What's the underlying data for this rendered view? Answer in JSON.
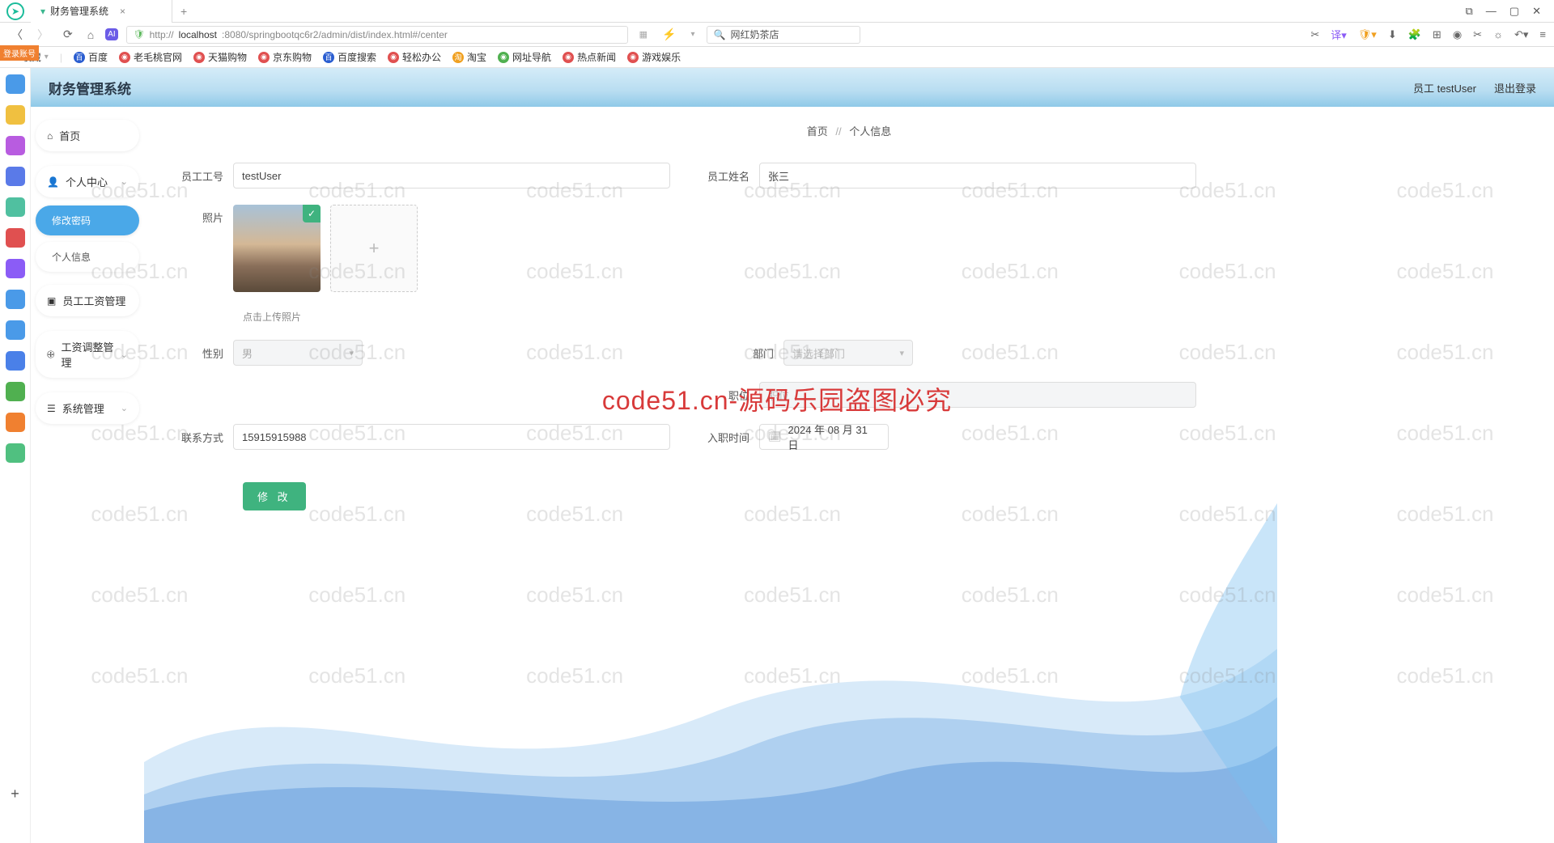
{
  "browser": {
    "tab_title": "财务管理系统",
    "url_prefix": "http://",
    "url_host": "localhost",
    "url_port_path": ":8080/springbootqc6r2/admin/dist/index.html#/center",
    "search_placeholder": "网红奶茶店",
    "login_badge": "登录账号"
  },
  "bookmarks": {
    "fav": "收藏",
    "items": [
      "百度",
      "老毛桃官网",
      "天猫购物",
      "京东购物",
      "百度搜索",
      "轻松办公",
      "淘宝",
      "网址导航",
      "热点新闻",
      "游戏娱乐"
    ]
  },
  "app": {
    "title": "财务管理系统",
    "user_prefix": "员工",
    "user_name": "testUser",
    "logout": "退出登录"
  },
  "sidebar": {
    "home": "首页",
    "personal": "个人中心",
    "sub_change_pwd": "修改密码",
    "sub_profile": "个人信息",
    "salary_mgmt": "员工工资管理",
    "salary_adjust": "工资调整管理",
    "system_mgmt": "系统管理"
  },
  "breadcrumb": {
    "home": "首页",
    "current": "个人信息"
  },
  "form": {
    "emp_id_label": "员工工号",
    "emp_id_value": "testUser",
    "emp_name_label": "员工姓名",
    "emp_name_value": "张三",
    "photo_label": "照片",
    "photo_hint": "点击上传照片",
    "gender_label": "性别",
    "gender_value": "男",
    "dept_label": "部门",
    "dept_placeholder": "请选择部门",
    "position_label": "职位",
    "position_placeholder": "职位",
    "contact_label": "联系方式",
    "contact_value": "15915915988",
    "hire_date_label": "入职时间",
    "hire_date_value": "2024 年 08 月 31 日",
    "submit": "修 改"
  },
  "watermark": {
    "small": "code51.cn",
    "big": "code51.cn-源码乐园盗图必究"
  }
}
